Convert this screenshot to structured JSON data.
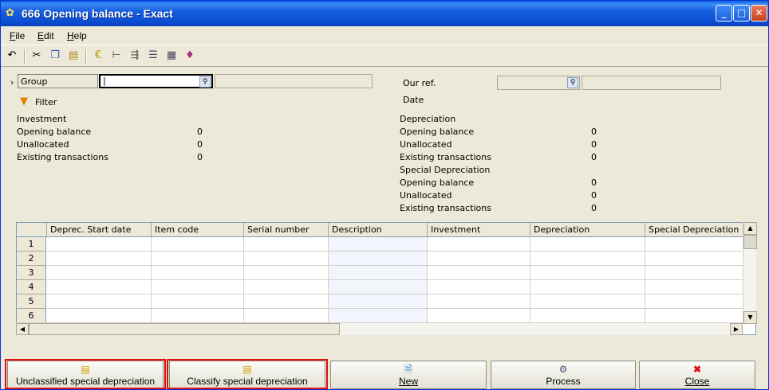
{
  "window": {
    "title": "666 Opening balance - Exact"
  },
  "menu": [
    {
      "label": "File",
      "key": "F",
      "rest": "ile"
    },
    {
      "label": "Edit",
      "key": "E",
      "rest": "dit"
    },
    {
      "label": "Help",
      "key": "H",
      "rest": "elp"
    }
  ],
  "toolbar": [
    "undo-icon",
    "cut-icon",
    "copy-icon",
    "paste-icon",
    "currency-icon",
    "link-icon",
    "transfer-icon",
    "preview-icon",
    "list-icon",
    "book-icon"
  ],
  "form": {
    "group_label": "Group",
    "group_value": "",
    "filter_label": "Filter",
    "our_ref_label": "Our ref.",
    "date_label": "Date"
  },
  "investment": {
    "heading": "Investment",
    "rows": [
      {
        "label": "Opening balance",
        "value": "0"
      },
      {
        "label": "Unallocated",
        "value": "0"
      },
      {
        "label": "Existing transactions",
        "value": "0"
      }
    ]
  },
  "depreciation": {
    "heading": "Depreciation",
    "rows": [
      {
        "label": "Opening balance",
        "value": "0"
      },
      {
        "label": "Unallocated",
        "value": "0"
      },
      {
        "label": "Existing transactions",
        "value": "0"
      }
    ],
    "special_heading": "Special Depreciation",
    "special_rows": [
      {
        "label": "Opening balance",
        "value": "0"
      },
      {
        "label": "Unallocated",
        "value": "0"
      },
      {
        "label": "Existing transactions",
        "value": "0"
      }
    ]
  },
  "table": {
    "columns": [
      "Deprec. Start date",
      "Item code",
      "Serial number",
      "Description",
      "Investment",
      "Depreciation",
      "Special Depreciation"
    ],
    "rows": [
      "1",
      "2",
      "3",
      "4",
      "5",
      "6"
    ]
  },
  "buttons": {
    "unclassified": "Unclassified special depreciation",
    "classify": "Classify special depreciation",
    "new": "New",
    "process": "Process",
    "close": "Close"
  }
}
